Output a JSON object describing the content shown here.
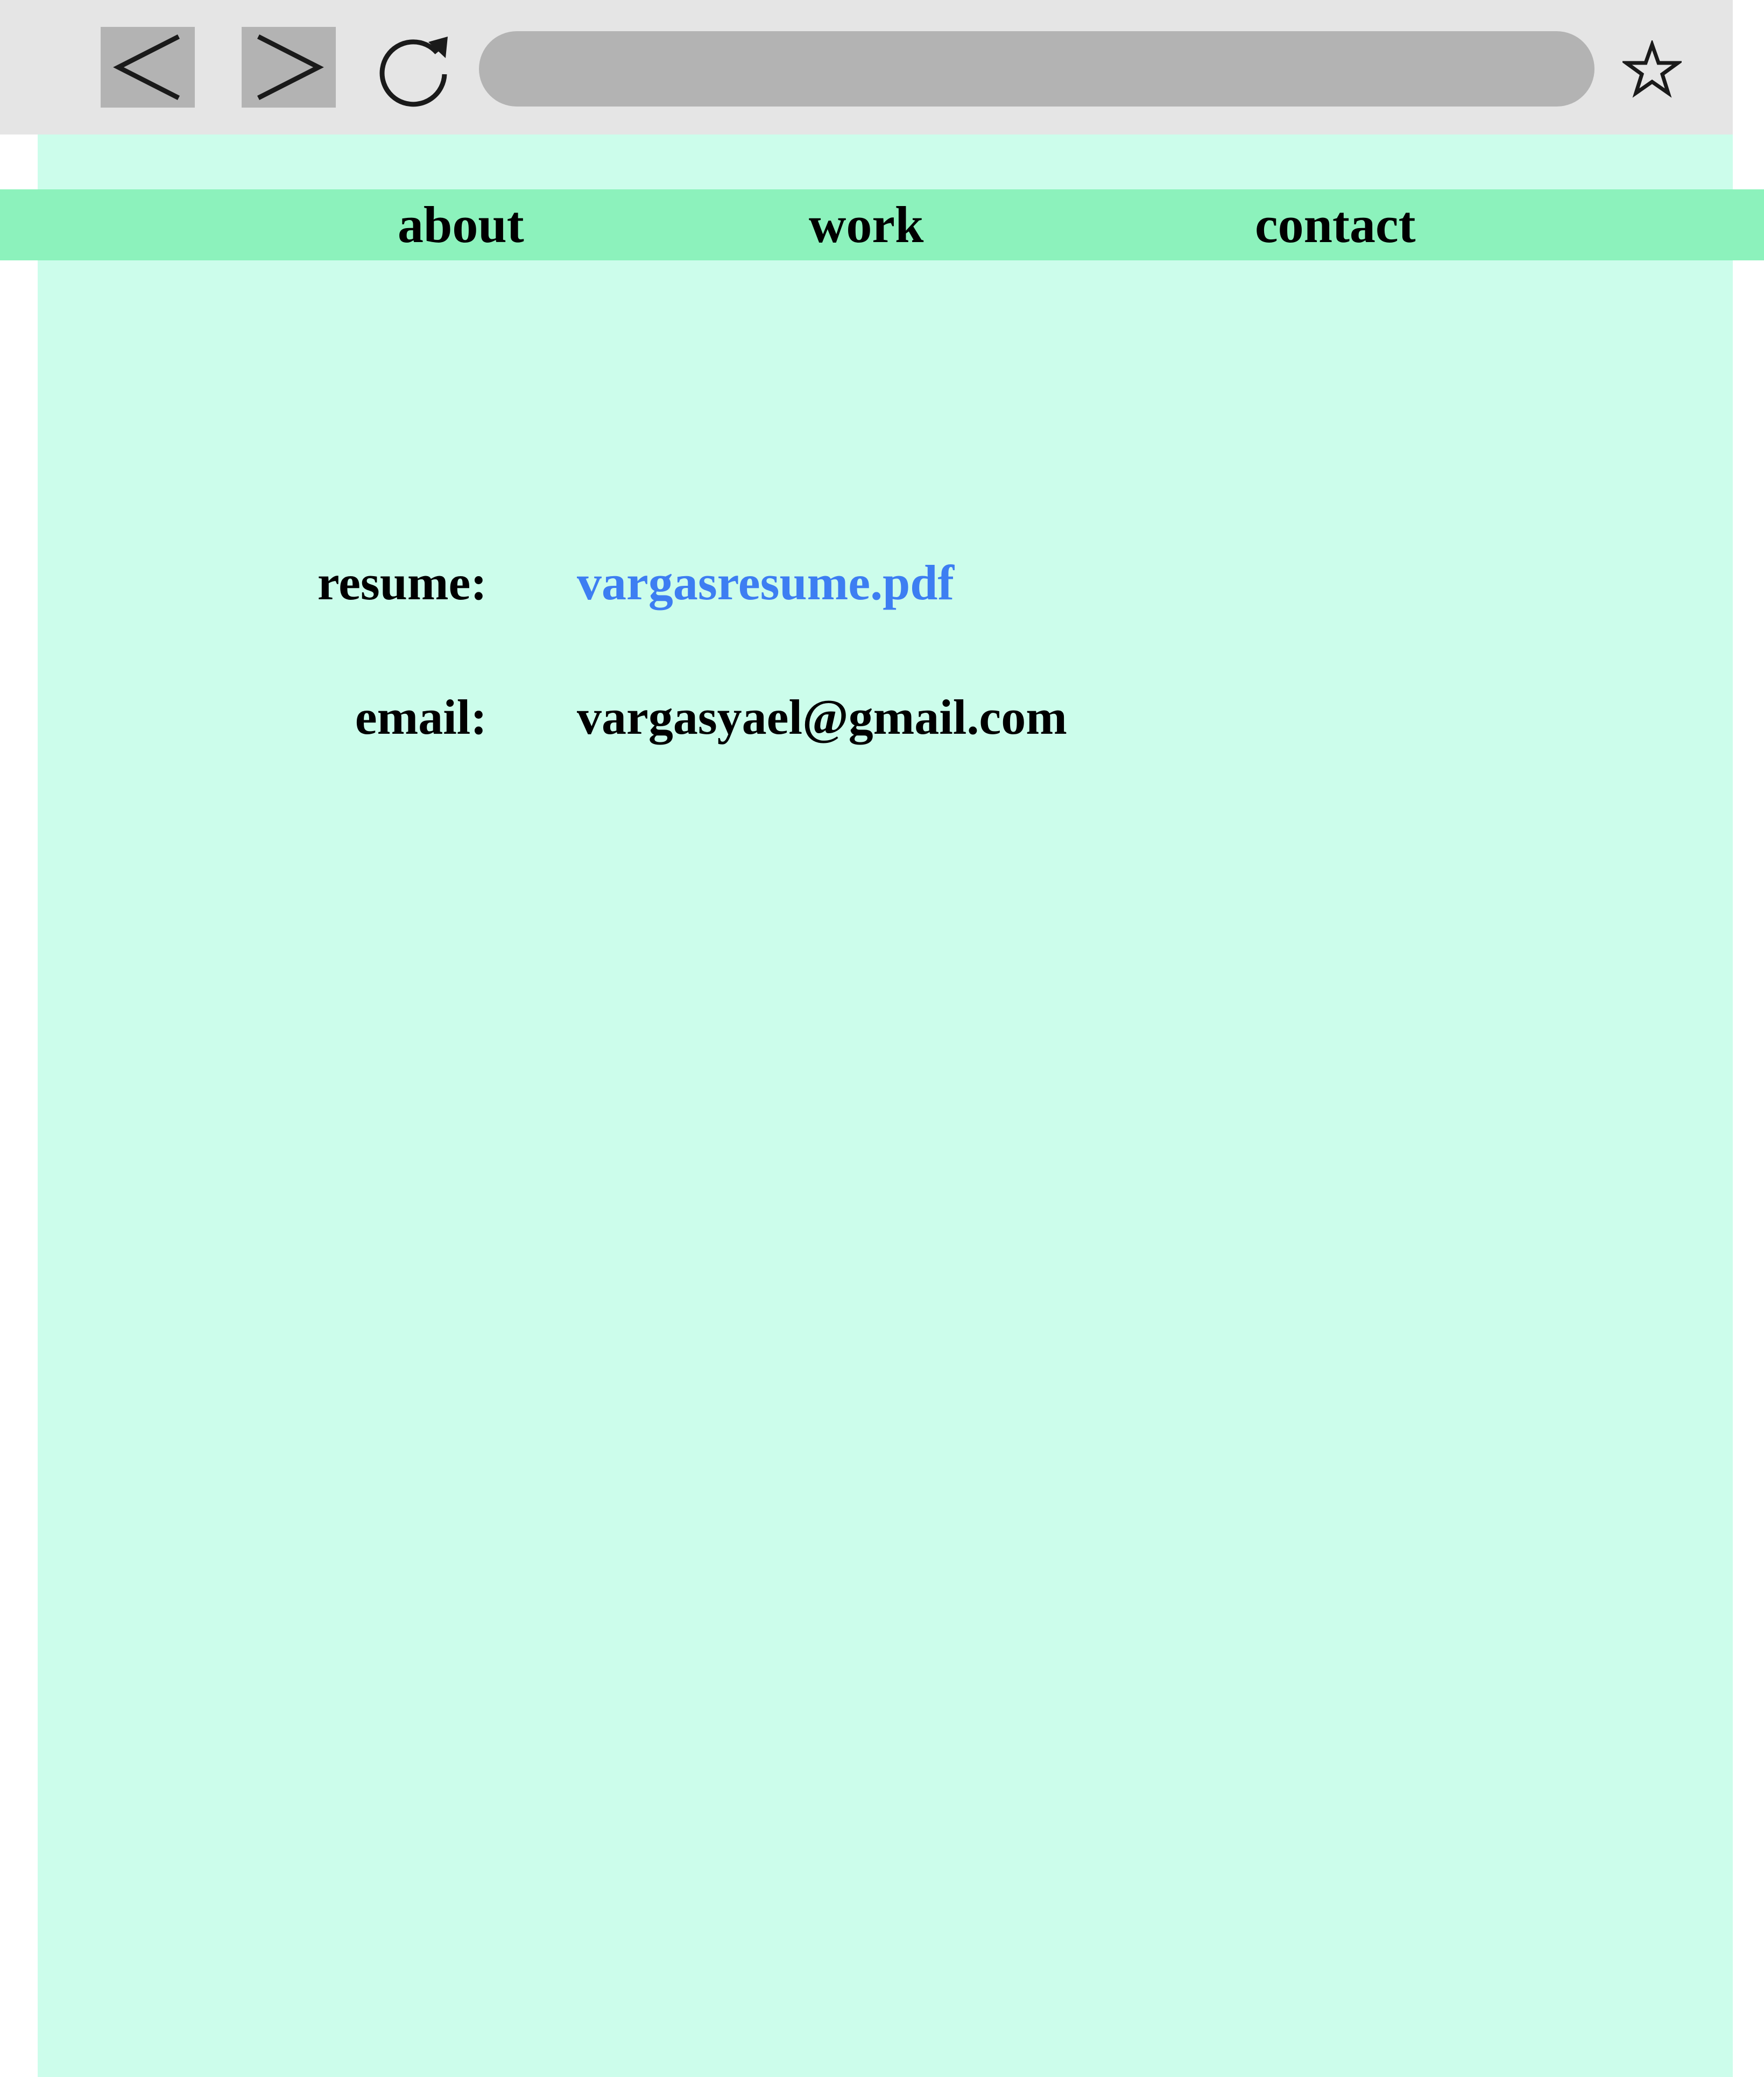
{
  "browser": {
    "back_icon": "chevron-left-icon",
    "forward_icon": "chevron-right-icon",
    "reload_icon": "reload-icon",
    "bookmark_icon": "star-icon",
    "url": ""
  },
  "nav": {
    "items": [
      {
        "label": "about"
      },
      {
        "label": "work"
      },
      {
        "label": "contact"
      }
    ]
  },
  "contact": {
    "resume_label": "resume:",
    "resume_value": "vargasresume.pdf",
    "email_label": "email:",
    "email_value": "vargasyael@gmail.com"
  },
  "colors": {
    "page_bg": "#ccfdeb",
    "navbar_bg": "#8cf2bc",
    "link": "#3d7ef2",
    "chrome_bg": "#e5e5e5",
    "chrome_control": "#b3b3b3"
  }
}
